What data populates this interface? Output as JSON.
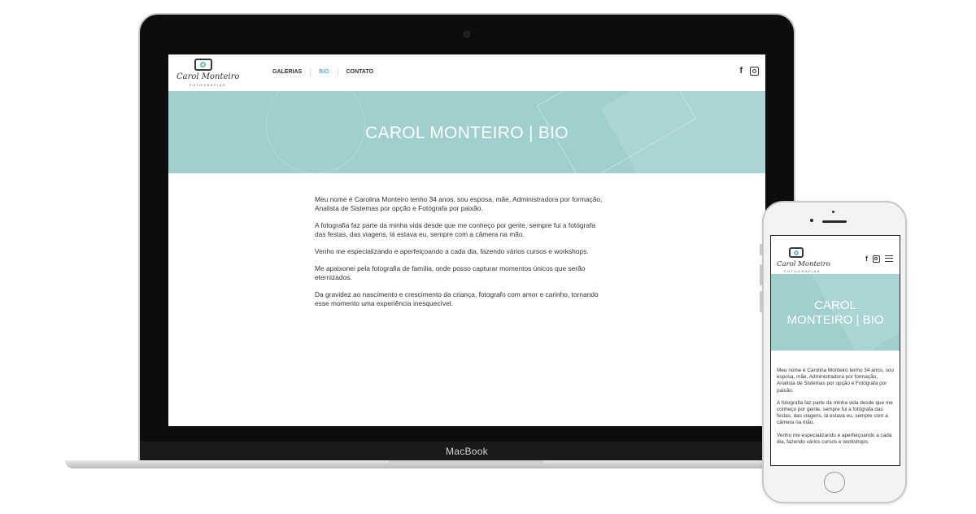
{
  "site": {
    "logo": {
      "script": "Carol Monteiro",
      "sub": "FOTOGRAFIAS"
    },
    "nav": [
      {
        "label": "GALERIAS",
        "active": false
      },
      {
        "label": "BIO",
        "active": true
      },
      {
        "label": "CONTATO",
        "active": false
      }
    ],
    "social": {
      "facebook": "f"
    },
    "hero_title": "CAROL MONTEIRO | BIO",
    "mobile_hero_title_line1": "CAROL",
    "mobile_hero_title_line2": "MONTEIRO | BIO",
    "bio": [
      "Meu nome é Carolina Monteiro tenho 34 anos, sou esposa, mãe, Administradora por formação, Analista de Sistemas por opção e Fotógrafa por paixão.",
      "A fotografia faz parte da minha vida desde que me conheço por gente, sempre fui a fotógrafa das festas, das viagens, lá estava eu, sempre com a câmera na mão.",
      "Venho me especializando e aperfeiçoando a cada dia, fazendo vários cursos e workshops.",
      "Me apaixonei pela fotografia de família, onde posso capturar momentos únicos que serão eternizados.",
      "Da gravidez ao nascimento e crescimento da criança, fotografo com amor e carinho, tornando esse momento uma experiência inesquecível."
    ]
  },
  "device": {
    "laptop_brand": "MacBook"
  },
  "colors": {
    "accent": "#5fb3b3",
    "hero": "#9fd0ce",
    "bezel": "#0d0d0d"
  }
}
